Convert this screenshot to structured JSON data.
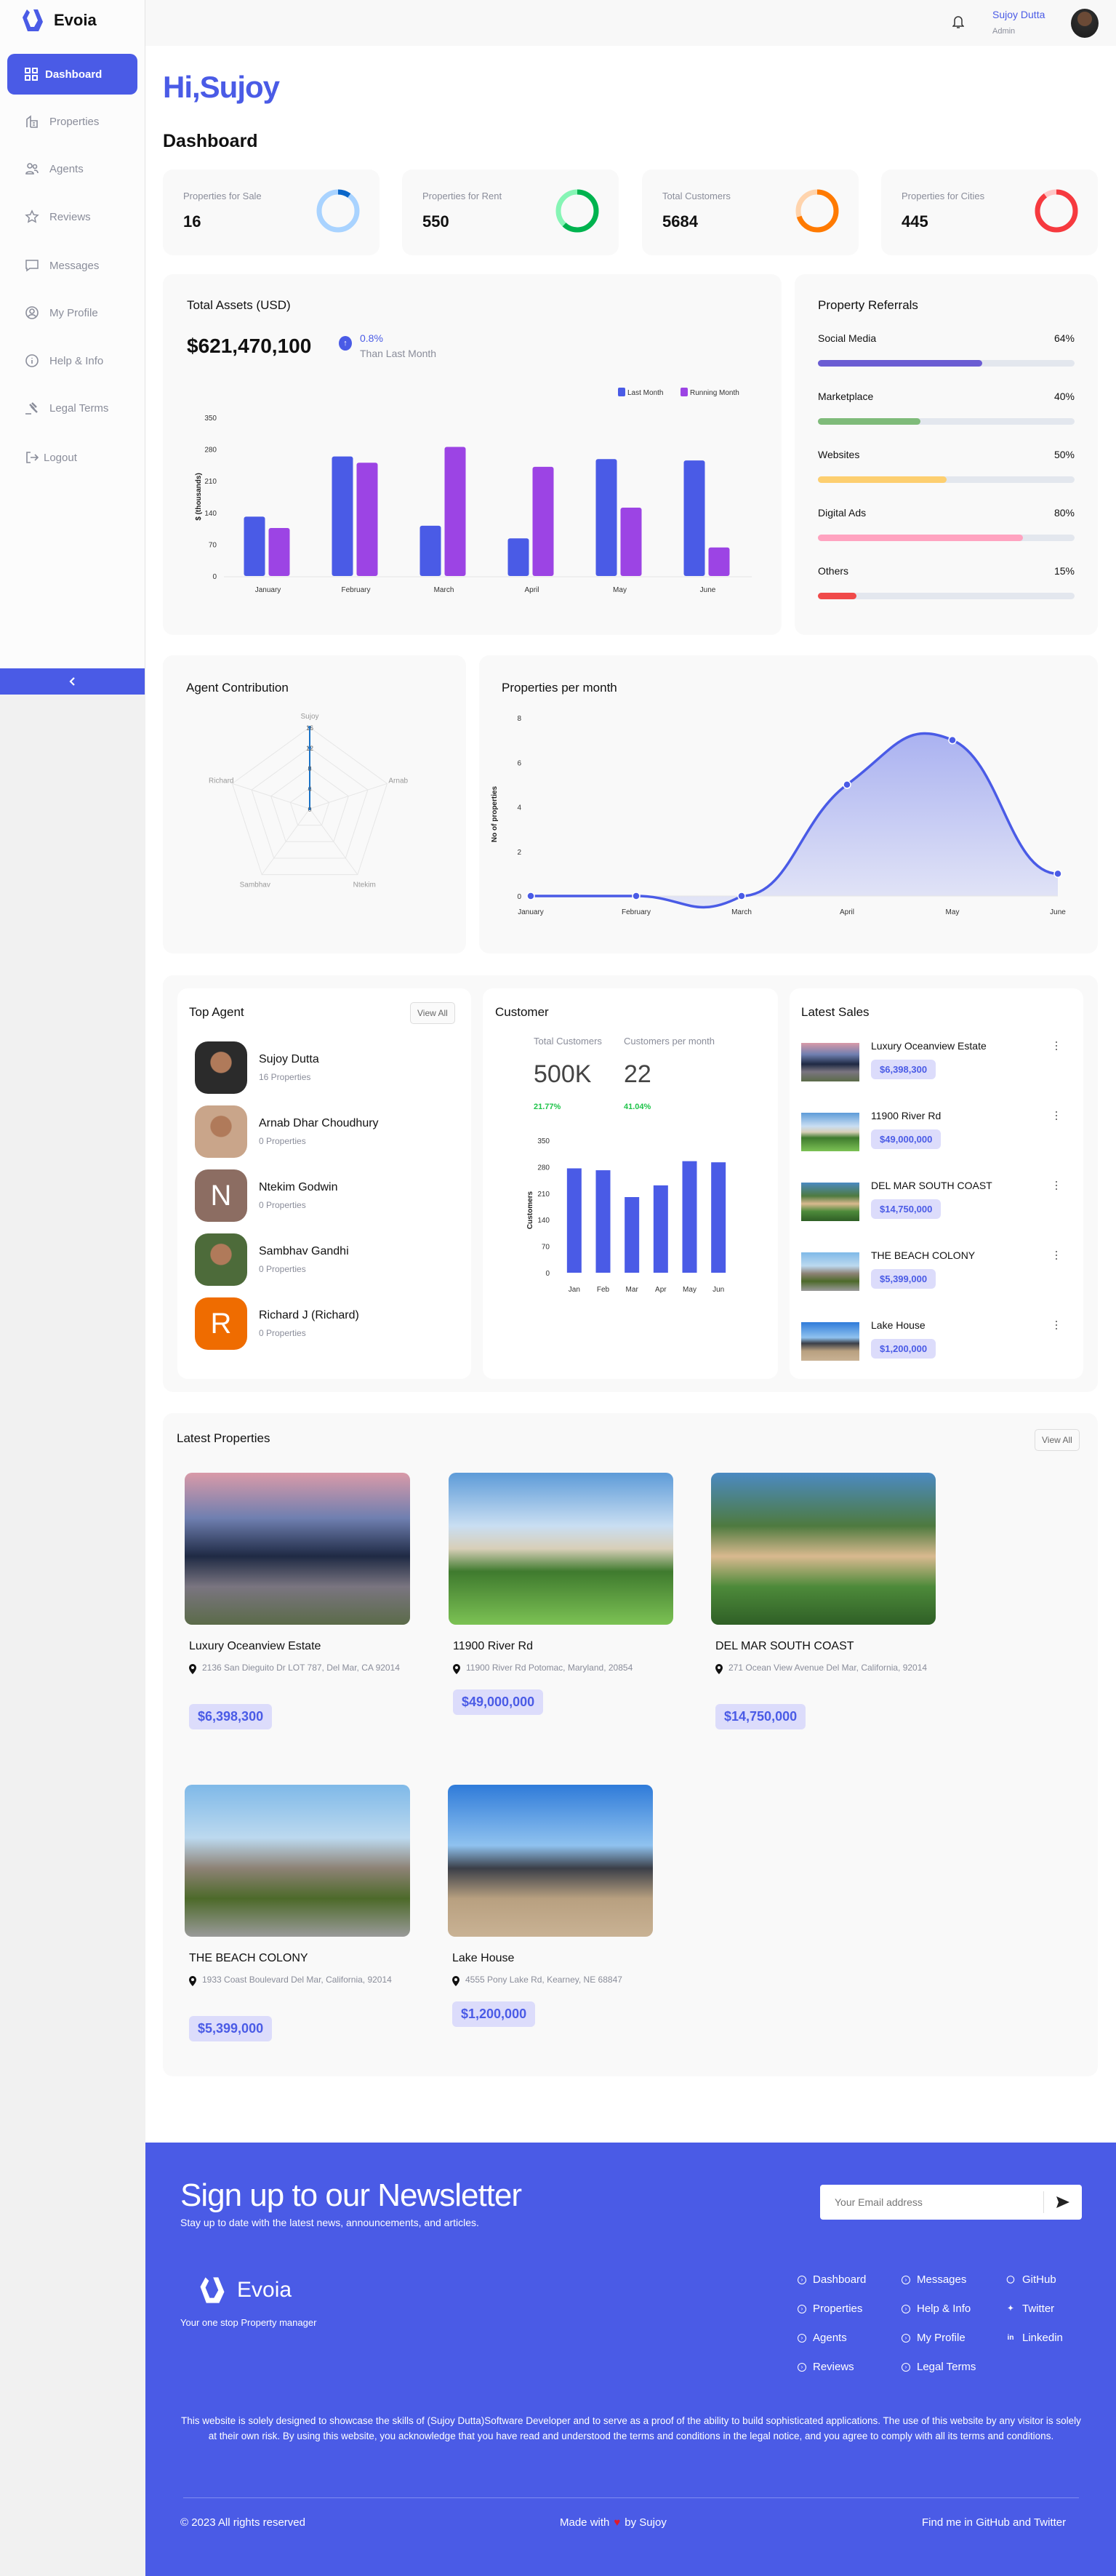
{
  "app": {
    "name": "Evoia",
    "accent": "#4a5be6"
  },
  "topbar": {
    "user_name": "Sujoy Dutta",
    "user_role": "Admin",
    "bell_icon": "bell-icon"
  },
  "sidebar": {
    "items": [
      {
        "label": "Dashboard",
        "icon": "grid-icon",
        "active": true
      },
      {
        "label": "Properties",
        "icon": "building-icon"
      },
      {
        "label": "Agents",
        "icon": "users-icon"
      },
      {
        "label": "Reviews",
        "icon": "star-icon"
      },
      {
        "label": "Messages",
        "icon": "message-icon"
      },
      {
        "label": "My Profile",
        "icon": "user-circle-icon"
      },
      {
        "label": "Help & Info",
        "icon": "info-icon"
      },
      {
        "label": "Legal Terms",
        "icon": "gavel-icon"
      },
      {
        "label": "Logout",
        "icon": "logout-icon"
      }
    ],
    "collapse_icon": "chevron-left-icon"
  },
  "greeting": "Hi,Sujoy",
  "page_title": "Dashboard",
  "stats": [
    {
      "label": "Properties for Sale",
      "value": "16",
      "ring_fill": 0.1,
      "color": "#0a66c9",
      "track": "#a9d3ff"
    },
    {
      "label": "Properties for Rent",
      "value": "550",
      "ring_fill": 0.62,
      "color": "#00b34f",
      "track": "#86f5b5"
    },
    {
      "label": "Total Customers",
      "value": "5684",
      "ring_fill": 0.7,
      "color": "#ff7a00",
      "track": "#ffd4ad"
    },
    {
      "label": "Properties for Cities",
      "value": "445",
      "ring_fill": 0.9,
      "color": "#f63a3f",
      "track": "#ffc6c6"
    }
  ],
  "assets": {
    "title": "Total Assets (USD)",
    "value": "$621,470,100",
    "change": "0.8%",
    "change_caption": "Than Last Month"
  },
  "referrals": {
    "title": "Property Referrals",
    "items": [
      {
        "label": "Social Media",
        "percent_label": "64%",
        "value": 64,
        "color": "#6b5dd3"
      },
      {
        "label": "Marketplace",
        "percent_label": "40%",
        "value": 40,
        "color": "#7fbb7a"
      },
      {
        "label": "Websites",
        "percent_label": "50%",
        "value": 50,
        "color": "#fdcf70"
      },
      {
        "label": "Digital Ads",
        "percent_label": "80%",
        "value": 80,
        "color": "#ffa3c0"
      },
      {
        "label": "Others",
        "percent_label": "15%",
        "value": 15,
        "color": "#f04a4a"
      }
    ]
  },
  "agent_contribution": {
    "title": "Agent Contribution"
  },
  "properties_per_month": {
    "title": "Properties per month"
  },
  "customer": {
    "title": "Customer",
    "total_label": "Total Customers",
    "total_value": "500K",
    "total_change": "21.77%",
    "per_month_label": "Customers per month",
    "per_month_value": "22",
    "per_month_change": "41.04%"
  },
  "chart_data": [
    {
      "type": "bar",
      "categories": [
        "January",
        "February",
        "March",
        "April",
        "May",
        "June"
      ],
      "series": [
        {
          "name": "Last Month",
          "color": "#4a5be6",
          "values": [
            131,
            264,
            111,
            83,
            258,
            255
          ]
        },
        {
          "name": "Running Month",
          "color": "#9c44e4",
          "values": [
            106,
            250,
            285,
            241,
            151,
            63
          ]
        }
      ],
      "ylabel": "$ (thousands)",
      "yticks": [
        0,
        70,
        140,
        210,
        280,
        350
      ],
      "ylim": [
        0,
        350
      ],
      "legend": "top-right"
    },
    {
      "type": "radar",
      "categories": [
        "Sujoy",
        "Arnab",
        "Ntekim",
        "Sambhav",
        "Richard"
      ],
      "values": [
        16,
        0,
        0,
        0,
        0
      ],
      "rticks": [
        0,
        4,
        8,
        12,
        16
      ],
      "rlim": [
        0,
        16
      ],
      "color": "#1a73c8"
    },
    {
      "type": "area",
      "categories": [
        "January",
        "February",
        "March",
        "April",
        "May",
        "June"
      ],
      "values": [
        0,
        0,
        0,
        5,
        7,
        1
      ],
      "ylabel": "No of properties",
      "yticks": [
        0,
        2,
        4,
        6,
        8
      ],
      "ylim": [
        0,
        8
      ],
      "color": "#4a5be6"
    },
    {
      "type": "bar",
      "categories": [
        "Jan",
        "Feb",
        "Mar",
        "Apr",
        "May",
        "Jun"
      ],
      "values": [
        276,
        271,
        200,
        231,
        295,
        292
      ],
      "ylabel": "Customers",
      "yticks": [
        0,
        70,
        140,
        210,
        280,
        350
      ],
      "ylim": [
        0,
        350
      ],
      "color": "#4a5be6"
    }
  ],
  "top_agent": {
    "title": "Top Agent",
    "view_all": "View All",
    "agents": [
      {
        "name": "Sujoy Dutta",
        "sub": "16 Properties",
        "initial": "",
        "bg": "#2b2b2b"
      },
      {
        "name": "Arnab Dhar Choudhury",
        "sub": "0 Properties",
        "initial": "",
        "bg": "#c9a58a"
      },
      {
        "name": "Ntekim Godwin",
        "sub": "0 Properties",
        "initial": "N",
        "bg": "#8c6d62"
      },
      {
        "name": "Sambhav Gandhi",
        "sub": "0 Properties",
        "initial": "",
        "bg": "#4d6b3a"
      },
      {
        "name": "Richard J (Richard)",
        "sub": "0 Properties",
        "initial": "R",
        "bg": "#ef6c00"
      }
    ]
  },
  "latest_sales": {
    "title": "Latest Sales",
    "items": [
      {
        "name": "Luxury Oceanview Estate",
        "price": "$6,398,300"
      },
      {
        "name": "11900 River Rd",
        "price": "$49,000,000"
      },
      {
        "name": "DEL MAR SOUTH COAST",
        "price": "$14,750,000"
      },
      {
        "name": "THE BEACH COLONY",
        "price": "$5,399,000"
      },
      {
        "name": "Lake House",
        "price": "$1,200,000"
      }
    ]
  },
  "latest_properties": {
    "title": "Latest Properties",
    "view_all": "View All",
    "items": [
      {
        "name": "Luxury Oceanview Estate",
        "address": "2136 San Dieguito Dr LOT 787, Del Mar, CA 92014",
        "price": "$6,398,300"
      },
      {
        "name": "11900 River Rd",
        "address": "11900 River Rd Potomac, Maryland, 20854",
        "price": "$49,000,000"
      },
      {
        "name": "DEL MAR SOUTH COAST",
        "address": "271 Ocean View Avenue Del Mar, California, 92014",
        "price": "$14,750,000"
      },
      {
        "name": "THE BEACH COLONY",
        "address": "1933 Coast Boulevard Del Mar, California, 92014",
        "price": "$5,399,000"
      },
      {
        "name": "Lake House",
        "address": "4555 Pony Lake Rd, Kearney, NE 68847",
        "price": "$1,200,000"
      }
    ]
  },
  "footer": {
    "newsletter_title": "Sign up to our Newsletter",
    "newsletter_sub": "Stay up to date with the latest news, announcements, and articles.",
    "email_placeholder": "Your Email address",
    "brand": "Evoia",
    "tagline": "Your one stop Property manager",
    "links_col1": [
      "Dashboard",
      "Properties",
      "Agents",
      "Reviews"
    ],
    "links_col2": [
      "Messages",
      "Help & Info",
      "My Profile",
      "Legal Terms"
    ],
    "social": [
      "GitHub",
      "Twitter",
      "Linkedin"
    ],
    "disclaimer": "This website is solely designed to showcase the skills of (Sujoy Dutta)Software Developer and to serve as a proof of the ability to build sophisticated applications. The use of this website by any visitor is solely at their own risk. By using this website, you acknowledge that you have read and understood the terms and conditions in the legal notice, and you agree to comply with all its terms and conditions.",
    "copyright": "© 2023 All rights reserved",
    "made_with": "Made with",
    "made_by": "by Sujoy",
    "find_me": "Find me in GitHub and Twitter"
  }
}
